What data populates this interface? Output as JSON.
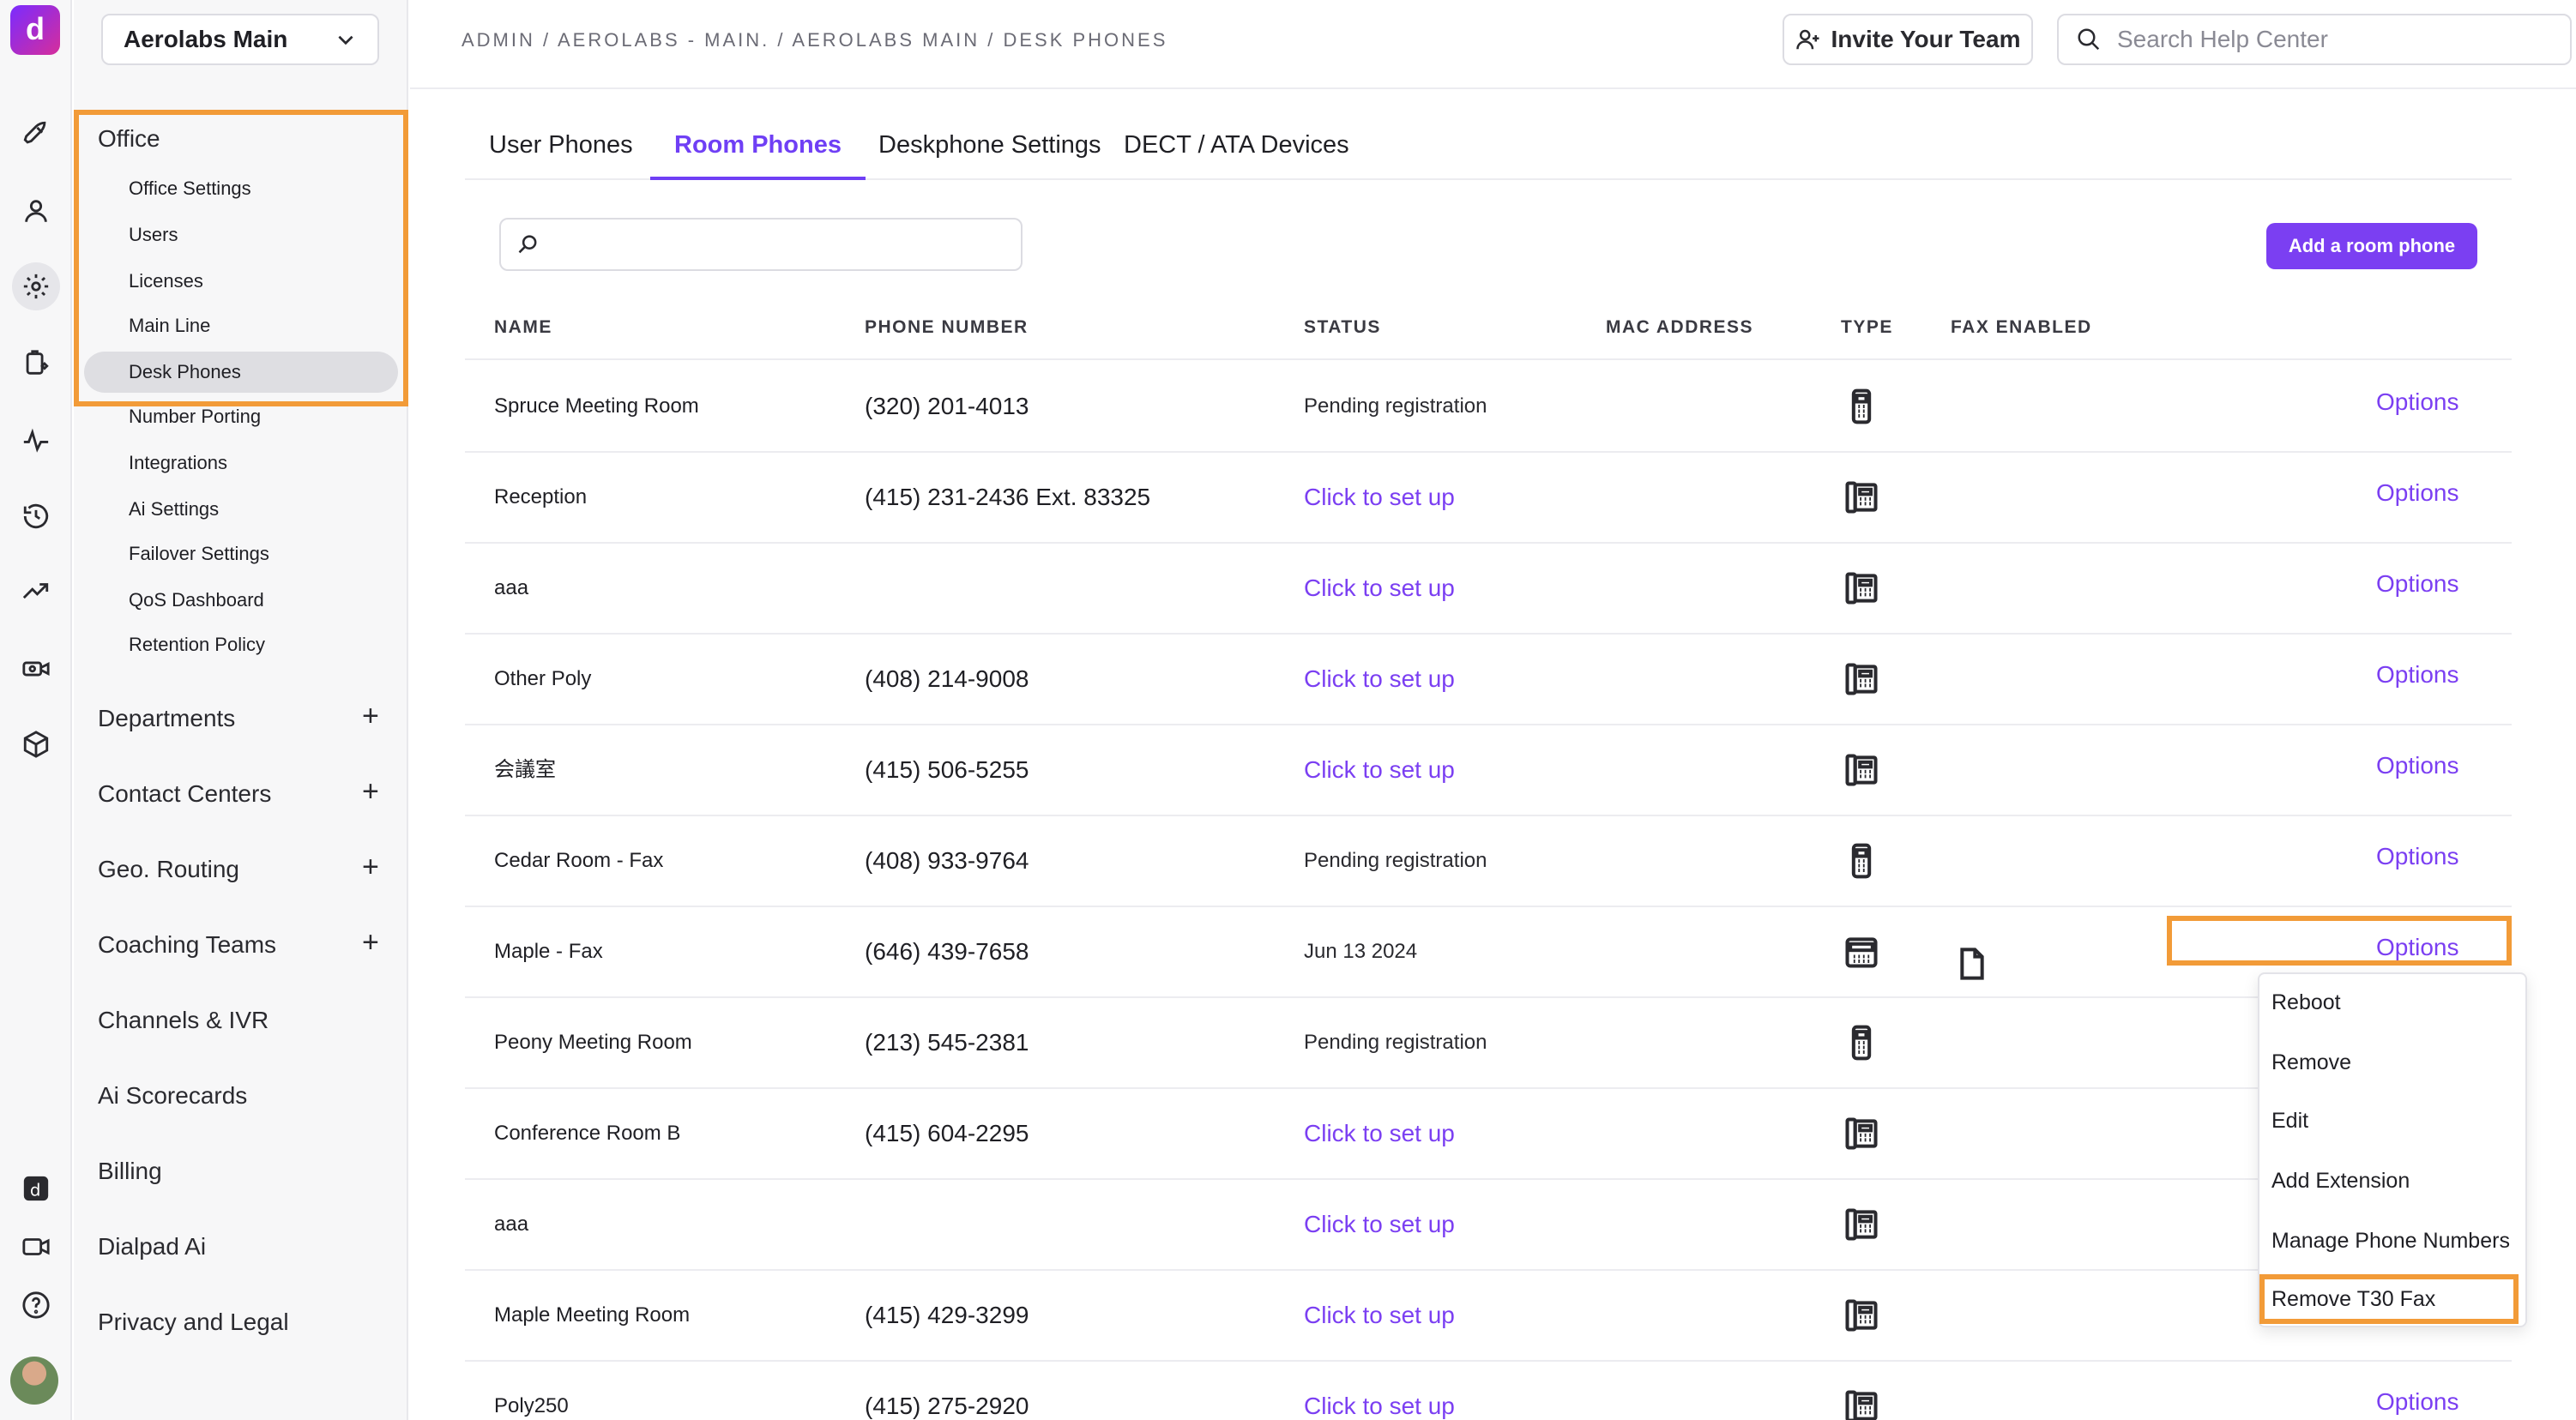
{
  "app": {
    "logo_letter": "d",
    "org_name": "Aerolabs Main"
  },
  "rail": {
    "icons": [
      "rocket-icon",
      "person-icon",
      "gear-icon",
      "clipboard-sparkle-icon",
      "pulse-icon",
      "history-icon",
      "trending-icon",
      "camera-icon",
      "cube-icon",
      "dialpad-ai-icon",
      "video-icon",
      "help-icon",
      "avatar"
    ]
  },
  "sidebar": {
    "office_title": "Office",
    "office_items": [
      "Office Settings",
      "Users",
      "Licenses",
      "Main Line",
      "Desk Phones",
      "Number Porting",
      "Integrations",
      "Ai Settings",
      "Failover Settings",
      "QoS Dashboard",
      "Retention Policy"
    ],
    "active_item": "Desk Phones",
    "sections": [
      {
        "label": "Departments",
        "expandable": true
      },
      {
        "label": "Contact Centers",
        "expandable": true
      },
      {
        "label": "Geo. Routing",
        "expandable": true
      },
      {
        "label": "Coaching Teams",
        "expandable": true
      },
      {
        "label": "Channels & IVR",
        "expandable": false
      },
      {
        "label": "Ai Scorecards",
        "expandable": false
      },
      {
        "label": "Billing",
        "expandable": false
      },
      {
        "label": "Dialpad Ai",
        "expandable": false
      },
      {
        "label": "Privacy and Legal",
        "expandable": false
      }
    ],
    "plus_symbol": "+"
  },
  "header": {
    "breadcrumb": "ADMIN / AEROLABS - MAIN. / AEROLABS MAIN / DESK PHONES",
    "invite_label": "Invite Your Team",
    "search_placeholder": "Search Help Center"
  },
  "tabs": [
    {
      "label": "User Phones",
      "active": false
    },
    {
      "label": "Room Phones",
      "active": true
    },
    {
      "label": "Deskphone Settings",
      "active": false
    },
    {
      "label": "DECT / ATA Devices",
      "active": false
    }
  ],
  "toolbar": {
    "search_value": "",
    "add_label": "Add a room phone"
  },
  "table": {
    "columns": [
      "NAME",
      "PHONE NUMBER",
      "STATUS",
      "MAC ADDRESS",
      "TYPE",
      "FAX ENABLED"
    ],
    "rows": [
      {
        "name": "Spruce Meeting Room",
        "phone": "(320) 201-4013",
        "status": "Pending registration",
        "status_link": false,
        "type": "mobile-phone-icon",
        "fax": false,
        "options": "Options"
      },
      {
        "name": "Reception",
        "phone": "(415) 231-2436 Ext. 83325",
        "status": "Click to set up",
        "status_link": true,
        "type": "desk-phone-icon",
        "fax": false,
        "options": "Options"
      },
      {
        "name": "aaa",
        "phone": "",
        "status": "Click to set up",
        "status_link": true,
        "type": "desk-phone-icon",
        "fax": false,
        "options": "Options"
      },
      {
        "name": "Other Poly",
        "phone": "(408) 214-9008",
        "status": "Click to set up",
        "status_link": true,
        "type": "desk-phone-icon",
        "fax": false,
        "options": "Options"
      },
      {
        "name": "会議室",
        "phone": "(415) 506-5255",
        "status": "Click to set up",
        "status_link": true,
        "type": "desk-phone-icon",
        "fax": false,
        "options": "Options"
      },
      {
        "name": "Cedar Room - Fax",
        "phone": "(408) 933-9764",
        "status": "Pending registration",
        "status_link": false,
        "type": "mobile-phone-icon",
        "fax": false,
        "options": "Options"
      },
      {
        "name": "Maple - Fax",
        "phone": "(646) 439-7658",
        "status": "Jun 13 2024",
        "status_link": false,
        "type": "fax-machine-icon",
        "fax": true,
        "options": "Options"
      },
      {
        "name": "Peony Meeting Room",
        "phone": "(213) 545-2381",
        "status": "Pending registration",
        "status_link": false,
        "type": "mobile-phone-icon",
        "fax": false,
        "options": ""
      },
      {
        "name": "Conference Room B",
        "phone": "(415) 604-2295",
        "status": "Click to set up",
        "status_link": true,
        "type": "desk-phone-icon",
        "fax": false,
        "options": ""
      },
      {
        "name": "aaa",
        "phone": "",
        "status": "Click to set up",
        "status_link": true,
        "type": "desk-phone-icon",
        "fax": false,
        "options": ""
      },
      {
        "name": "Maple Meeting Room",
        "phone": "(415) 429-3299",
        "status": "Click to set up",
        "status_link": true,
        "type": "desk-phone-icon",
        "fax": false,
        "options": ""
      },
      {
        "name": "Poly250",
        "phone": "(415) 275-2920",
        "status": "Click to set up",
        "status_link": true,
        "type": "desk-phone-icon",
        "fax": false,
        "options": "Options"
      }
    ]
  },
  "options_menu": {
    "items": [
      "Reboot",
      "Remove",
      "Edit",
      "Add Extension",
      "Manage Phone Numbers",
      "Remove T30 Fax"
    ],
    "highlighted": "Remove T30 Fax"
  },
  "colors": {
    "accent": "#7b3ff2",
    "highlight_outline": "#f29b38"
  }
}
